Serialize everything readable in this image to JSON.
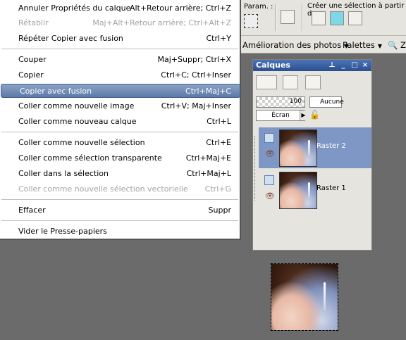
{
  "toolbar": {
    "param_label": "Param. :",
    "selection_label": "Créer une sélection à partir de :"
  },
  "menubar": {
    "items": [
      {
        "label": "Amélioration des photos"
      },
      {
        "label": "Palettes"
      },
      {
        "label": "Z"
      }
    ]
  },
  "menu": {
    "items": [
      {
        "label": "Annuler Propriétés du calque",
        "shortcut": "Alt+Retour arrière; Ctrl+Z",
        "state": "enabled"
      },
      {
        "label": "Rétablir",
        "shortcut": "Maj+Alt+Retour arrière; Ctrl+Alt+Z",
        "state": "disabled"
      },
      {
        "label": "Répéter  Copier avec fusion",
        "shortcut": "Ctrl+Y",
        "state": "enabled"
      },
      {
        "label": "Couper",
        "shortcut": "Maj+Suppr; Ctrl+X",
        "state": "enabled"
      },
      {
        "label": "Copier",
        "shortcut": "Ctrl+C; Ctrl+Inser",
        "state": "enabled"
      },
      {
        "label": "Copier avec fusion",
        "shortcut": "Ctrl+Maj+C",
        "state": "highlighted"
      },
      {
        "label": "Coller comme nouvelle image",
        "shortcut": "Ctrl+V; Maj+Inser",
        "state": "enabled"
      },
      {
        "label": "Coller comme nouveau calque",
        "shortcut": "Ctrl+L",
        "state": "enabled"
      },
      {
        "label": "Coller comme nouvelle sélection",
        "shortcut": "Ctrl+E",
        "state": "enabled"
      },
      {
        "label": "Coller comme sélection transparente",
        "shortcut": "Ctrl+Maj+E",
        "state": "enabled"
      },
      {
        "label": "Coller dans la sélection",
        "shortcut": "Ctrl+Maj+L",
        "state": "enabled"
      },
      {
        "label": "Coller comme nouvelle sélection vectorielle",
        "shortcut": "Ctrl+G",
        "state": "disabled"
      },
      {
        "label": "Effacer",
        "shortcut": "Suppr",
        "state": "enabled"
      },
      {
        "label": "Vider le Presse-papiers",
        "shortcut": "",
        "state": "enabled"
      }
    ]
  },
  "layers": {
    "title": "Calques",
    "opacity": "100",
    "mask_label": "Aucune",
    "blend_mode": "Écran",
    "rows": [
      {
        "name": "Raster 2",
        "selected": true
      },
      {
        "name": "Raster 1",
        "selected": false
      }
    ]
  },
  "colors": {
    "highlight": "#5c7aa8",
    "title_bar": "#2b4f8f",
    "selected_layer": "#7e97c4",
    "workspace": "#6b6b6b"
  }
}
